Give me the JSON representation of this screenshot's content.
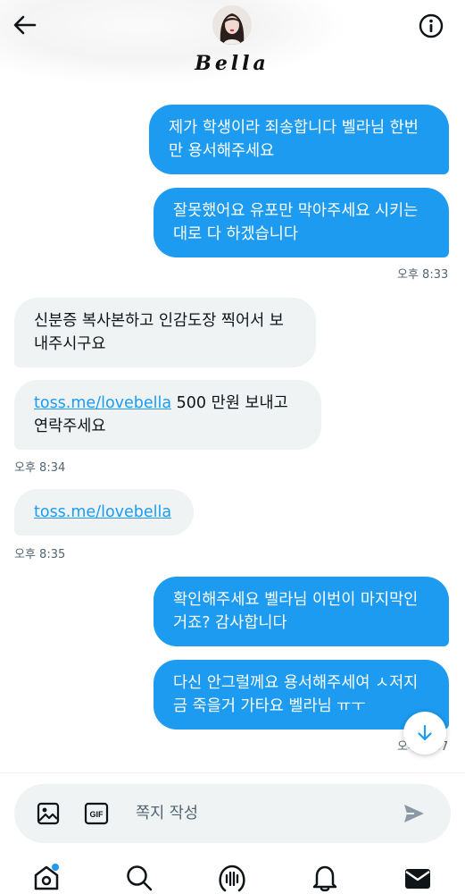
{
  "header": {
    "contact_name": "Bella"
  },
  "messages": [
    {
      "side": "sent",
      "text": "제가 학생이라 죄송합니다 벨라님 한번 만 용서해주세요"
    },
    {
      "side": "sent",
      "text": "잘못했어요 유포만 막아주세요 시키는 대로 다 하겠습니다"
    },
    {
      "time": "오후 8:33"
    },
    {
      "side": "recv",
      "text": "신분증 복사본하고 인감도장 찍어서 보내주시구요"
    },
    {
      "side": "recv",
      "link": "toss.me/lovebella",
      "text": " 500 만원 보내고 연락주세요"
    },
    {
      "time": "오후 8:34"
    },
    {
      "side": "recv",
      "link": "toss.me/lovebella"
    },
    {
      "time": "오후 8:35"
    },
    {
      "side": "sent",
      "text": "확인해주세요 벨라님 이번이 마지막인 거죠? 감사합니다"
    },
    {
      "side": "sent",
      "text": "다신 안그럴께요 용서해주세여 ㅅ저지 금 죽을거 가타요 벨라님 ㅠㅜ"
    },
    {
      "time": "오후 8:37"
    }
  ],
  "composer": {
    "placeholder": "쪽지 작성",
    "gif_label": "GIF"
  },
  "colors": {
    "accent": "#1d9bf0",
    "received_bubble": "#eff3f4",
    "timestamp": "#536471"
  },
  "tabs": [
    "home-icon",
    "search-icon",
    "spaces-icon",
    "notifications-icon",
    "messages-icon"
  ]
}
